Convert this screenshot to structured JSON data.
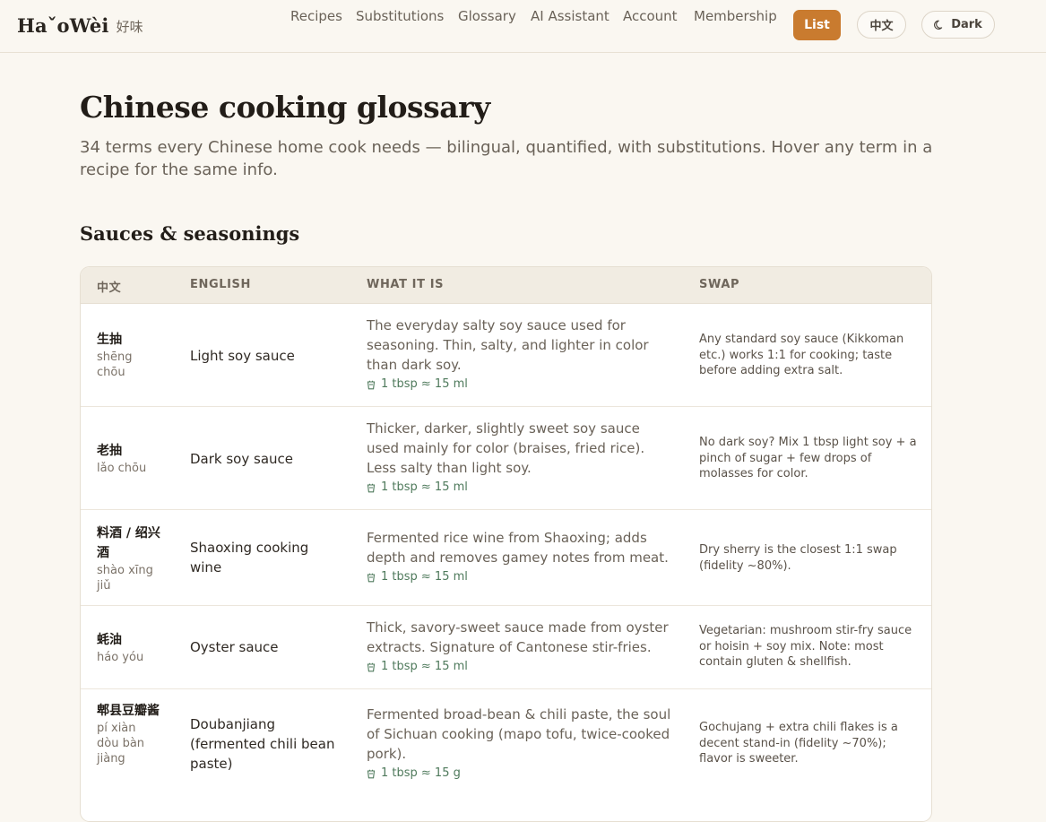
{
  "brand": {
    "name": "HaˇoWèi",
    "cn": "好味"
  },
  "nav": {
    "items": [
      "Recipes",
      "Substitutions",
      "Glossary",
      "AI Assistant",
      "Account",
      "Membership"
    ],
    "list_label": "List",
    "lang_label": "中文",
    "theme_label": "Dark"
  },
  "main": {
    "title": "Chinese cooking glossary",
    "subtitle": "34 terms every Chinese home cook needs — bilingual, quantified, with substitutions. Hover any term in a recipe for the same info.",
    "section_title": "Sauces & seasonings"
  },
  "table": {
    "headers": [
      "中文",
      "ENGLISH",
      "WHAT IT IS",
      "SWAP"
    ],
    "rows": [
      {
        "cn": "生抽",
        "pinyin": "shēng chōu",
        "en": "Light soy sauce",
        "what": "The everyday salty soy sauce used for seasoning. Thin, salty, and lighter in color than dark soy.",
        "measure": "1 tbsp ≈ 15 ml",
        "swap": "Any standard soy sauce (Kikkoman etc.) works 1:1 for cooking; taste before adding extra salt."
      },
      {
        "cn": "老抽",
        "pinyin": "lǎo chōu",
        "en": "Dark soy sauce",
        "what": "Thicker, darker, slightly sweet soy sauce used mainly for color (braises, fried rice). Less salty than light soy.",
        "measure": "1 tbsp ≈ 15 ml",
        "swap": "No dark soy? Mix 1 tbsp light soy + a pinch of sugar + few drops of molasses for color."
      },
      {
        "cn": "料酒 / 绍兴酒",
        "pinyin": "shào xīng jiǔ",
        "en": "Shaoxing cooking wine",
        "what": "Fermented rice wine from Shaoxing; adds depth and removes gamey notes from meat.",
        "measure": "1 tbsp ≈ 15 ml",
        "swap": "Dry sherry is the closest 1:1 swap (fidelity ~80%)."
      },
      {
        "cn": "蚝油",
        "pinyin": "háo yóu",
        "en": "Oyster sauce",
        "what": "Thick, savory-sweet sauce made from oyster extracts. Signature of Cantonese stir-fries.",
        "measure": "1 tbsp ≈ 15 ml",
        "swap": "Vegetarian: mushroom stir-fry sauce or hoisin + soy mix. Note: most contain gluten & shellfish."
      },
      {
        "cn": "郫县豆瓣酱",
        "pinyin": "pí xiàn dòu bàn jiàng",
        "en": "Doubanjiang (fermented chili bean paste)",
        "what": "Fermented broad-bean & chili paste, the soul of Sichuan cooking (mapo tofu, twice-cooked pork).",
        "measure": "1 tbsp ≈ 15 g",
        "swap": "Gochujang + extra chili flakes is a decent stand-in (fidelity ~70%); flavor is sweeter."
      }
    ]
  }
}
